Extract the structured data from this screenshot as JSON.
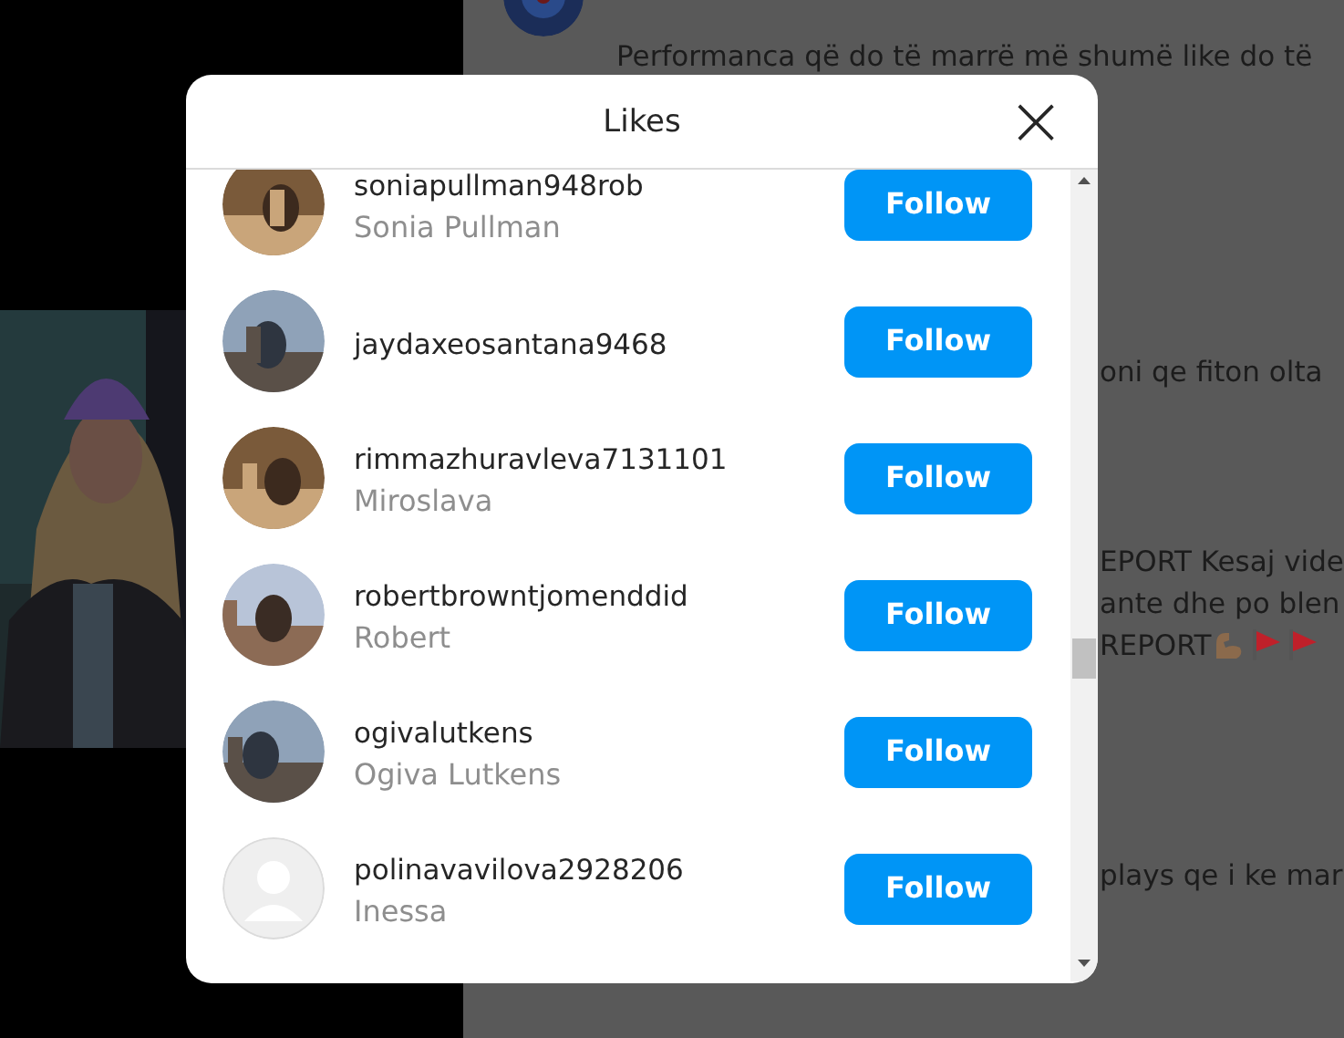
{
  "background": {
    "post_text": "Performanca që do të marrë më shumë like do të",
    "comments": [
      {
        "lines": [
          "oni qe fiton olta"
        ]
      },
      {
        "lines": [
          "EPORT Kesaj vide",
          "ante dhe po blen",
          "REPORT"
        ],
        "emoji_after_last": true
      },
      {
        "lines": [
          "plays qe i ke mar"
        ]
      }
    ]
  },
  "modal": {
    "title": "Likes",
    "close": "×",
    "users": [
      {
        "username": "soniapullman948rob",
        "name": "Sonia Pullman",
        "button": "Follow"
      },
      {
        "username": "jaydaxeosantana9468",
        "button": "Follow"
      },
      {
        "username": "rimmazhuravleva7131101",
        "name": "Miroslava",
        "button": "Follow"
      },
      {
        "username": "robertbrowntjomenddid",
        "name": "Robert",
        "button": "Follow"
      },
      {
        "username": "ogivalutkens",
        "name": "Ogiva Lutkens",
        "button": "Follow"
      },
      {
        "username": "polinavavilova2928206",
        "name": "Inessa",
        "button": "Follow",
        "kind": "no_photo"
      }
    ]
  }
}
